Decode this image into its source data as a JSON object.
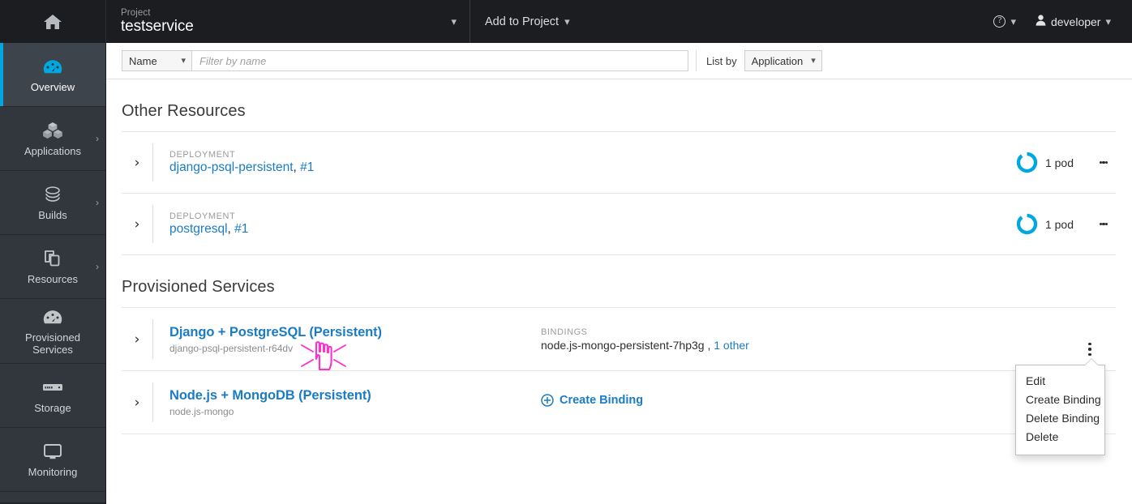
{
  "topbar": {
    "home_icon": "home-icon",
    "project_label": "Project",
    "project_name": "testservice",
    "add_to_project": "Add to Project",
    "help_icon": "help-icon",
    "user_icon": "user-icon",
    "user_name": "developer"
  },
  "sidebar": {
    "items": [
      {
        "label": "Overview",
        "icon": "gauge-icon",
        "active": true,
        "expandable": false
      },
      {
        "label": "Applications",
        "icon": "cubes-icon",
        "active": false,
        "expandable": true
      },
      {
        "label": "Builds",
        "icon": "layers-icon",
        "active": false,
        "expandable": true
      },
      {
        "label": "Resources",
        "icon": "copy-icon",
        "active": false,
        "expandable": true
      },
      {
        "label": "Provisioned Services",
        "icon": "gauge-icon",
        "active": false,
        "expandable": false
      },
      {
        "label": "Storage",
        "icon": "storage-icon",
        "active": false,
        "expandable": false
      },
      {
        "label": "Monitoring",
        "icon": "monitor-icon",
        "active": false,
        "expandable": false
      }
    ]
  },
  "filterbar": {
    "filter_type": "Name",
    "filter_placeholder": "Filter by name",
    "filter_value": "",
    "list_by_label": "List by",
    "list_by_value": "Application"
  },
  "other_resources": {
    "title": "Other Resources",
    "rows": [
      {
        "kind": "DEPLOYMENT",
        "name": "django-psql-persistent",
        "separator": ", ",
        "version": "#1",
        "pods": "1 pod",
        "pod_color": "#00a8e1"
      },
      {
        "kind": "DEPLOYMENT",
        "name": "postgresql",
        "separator": ", ",
        "version": "#1",
        "pods": "1 pod",
        "pod_color": "#00a8e1"
      }
    ]
  },
  "provisioned_services": {
    "title": "Provisioned Services",
    "rows": [
      {
        "title": "Django + PostgreSQL (Persistent)",
        "subtitle": "django-psql-persistent-r64dv",
        "bindings_label": "BINDINGS",
        "binding_value": "node.js-mongo-persistent-7hp3g ,",
        "binding_other": "1 other",
        "has_create_binding": false,
        "create_binding_label": ""
      },
      {
        "title": "Node.js + MongoDB (Persistent)",
        "subtitle": "node.js-mongo",
        "bindings_label": "",
        "binding_value": "",
        "binding_other": "",
        "has_create_binding": true,
        "create_binding_label": "Create Binding"
      }
    ]
  },
  "dropdown": {
    "items": [
      "Edit",
      "Create Binding",
      "Delete Binding",
      "Delete"
    ]
  },
  "colors": {
    "accent_blue": "#00a8e1",
    "link_blue": "#1b7cc3",
    "sidebar_bg": "#32373d",
    "topbar_bg": "#1b1d21",
    "cursor_pink": "#ff2fd0"
  }
}
